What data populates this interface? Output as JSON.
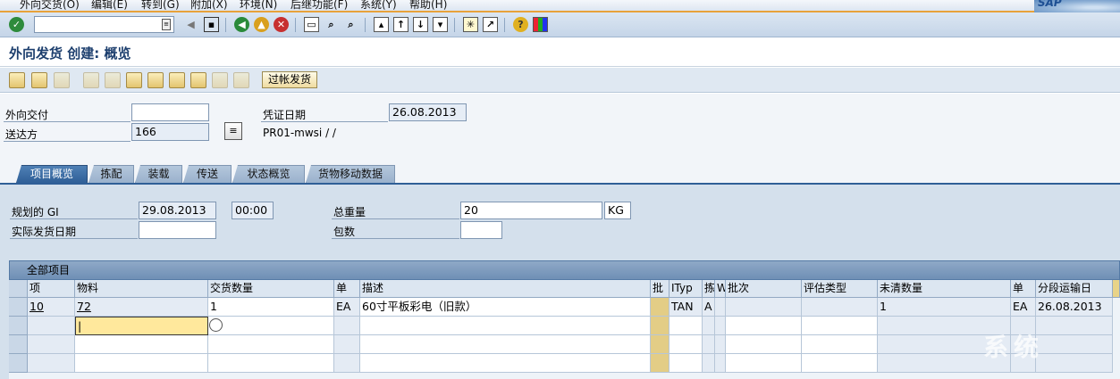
{
  "menu": [
    "外向交货(O)",
    "编辑(E)",
    "转到(G)",
    "附加(X)",
    "环境(N)",
    "后继功能(F)",
    "系统(Y)",
    "帮助(H)"
  ],
  "logo": "SAP",
  "title": "外向发货 创建: 概览",
  "app_toolbar": {
    "post_button": "过帐发货"
  },
  "header": {
    "outbound_delivery_label": "外向交付",
    "outbound_delivery_value": "",
    "ship_to_label": "送达方",
    "ship_to_value": "166",
    "doc_date_label": "凭证日期",
    "doc_date_value": "26.08.2013",
    "partner_text": "PR01-mwsi / /"
  },
  "tabs": [
    "项目概览",
    "拣配",
    "装载",
    "传送",
    "状态概览",
    "货物移动数据"
  ],
  "overview": {
    "planned_gi_label": "规划的 GI",
    "planned_gi_date": "29.08.2013",
    "planned_gi_time": "00:00",
    "actual_gi_label": "实际发货日期",
    "actual_gi_value": "",
    "total_weight_label": "总重量",
    "total_weight_value": "20",
    "weight_unit": "KG",
    "packages_label": "包数",
    "packages_value": ""
  },
  "table": {
    "title": "全部项目",
    "columns": [
      "项",
      "物料",
      "交货数量",
      "单",
      "描述",
      "批",
      "ITyp",
      "拣",
      "W",
      "批次",
      "评估类型",
      "未清数量",
      "单",
      "分段运输日"
    ],
    "rows": [
      {
        "item": "10",
        "material": "72",
        "qty": "1",
        "unit": "EA",
        "desc": "60寸平板彩电（旧款）",
        "batch_flag": "",
        "ityp": "TAN",
        "pick": "A",
        "w": "",
        "batch": "",
        "val_type": "",
        "open_qty": "1",
        "unit2": "EA",
        "stage_date": "26.08.2013"
      }
    ]
  },
  "watermark": "系统"
}
